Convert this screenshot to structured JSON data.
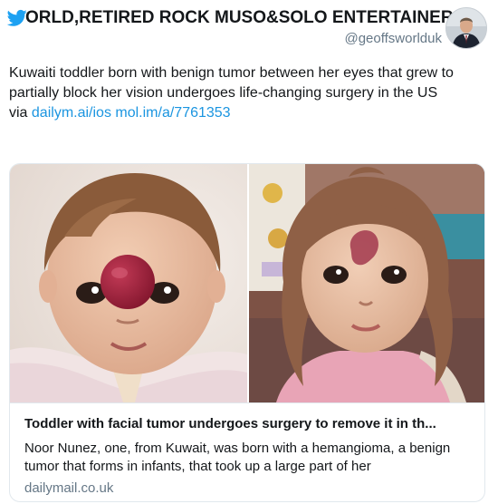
{
  "header": {
    "display_name": "ORLD,RETIRED ROCK MUSO&SOLO ENTERTAINER",
    "handle": "@geoffsworlduk",
    "icon": "twitter-bird-icon"
  },
  "tweet": {
    "text": "Kuwaiti toddler born with benign tumor between her eyes that grew to partially block her vision undergoes life-changing surgery in the US",
    "via_label": "via",
    "link1": "dailym.ai/ios",
    "link2": "mol.im/a/7761353"
  },
  "card": {
    "title": "Toddler with facial tumor undergoes surgery to remove it in th...",
    "description": "Noor Nunez, one, from Kuwait, was born with a hemangioma, a benign tumor that forms in infants, that took up a large part of her",
    "domain": "dailymail.co.uk"
  },
  "colors": {
    "link": "#1b95e0",
    "twitter_blue": "#1da1f2",
    "secondary_text": "#657786"
  }
}
